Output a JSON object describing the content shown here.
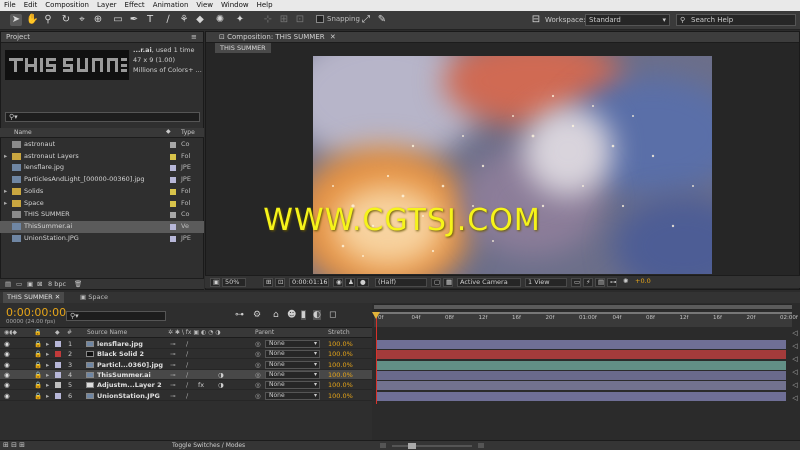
{
  "menu": [
    "File",
    "Edit",
    "Composition",
    "Layer",
    "Effect",
    "Animation",
    "View",
    "Window",
    "Help"
  ],
  "toolbar": {
    "snapping_label": "Snapping",
    "workspace_label": "Workspace:",
    "workspace_value": "Standard",
    "search_placeholder": "Search Help"
  },
  "project": {
    "tab": "Project",
    "preview_name": "...r.ai",
    "preview_used": ", used 1 time",
    "preview_dims": "47 x 9 (1.00)",
    "preview_colors": "Millions of Colors+ ...",
    "col_name": "Name",
    "col_type": "Type",
    "items": [
      {
        "name": "astronaut",
        "type": "Co",
        "label_color": "#a7a7a7",
        "icon": "composition-icon"
      },
      {
        "name": "astronaut Layers",
        "type": "Fol",
        "label_color": "#d8c34a",
        "icon": "folder-icon"
      },
      {
        "name": "lensflare.jpg",
        "type": "JPE",
        "label_color": "#b7b7d8",
        "icon": "image-icon"
      },
      {
        "name": "ParticlesAndLight_[00000-00360].jpg",
        "type": "JPE",
        "label_color": "#b7b7d8",
        "icon": "image-sequence-icon"
      },
      {
        "name": "Solids",
        "type": "Fol",
        "label_color": "#d8c34a",
        "icon": "folder-icon"
      },
      {
        "name": "Space",
        "type": "Fol",
        "label_color": "#d8c34a",
        "icon": "folder-icon"
      },
      {
        "name": "THIS SUMMER",
        "type": "Co",
        "label_color": "#a7a7a7",
        "icon": "composition-icon"
      },
      {
        "name": "ThisSummer.ai",
        "type": "Ve",
        "label_color": "#b7b7d8",
        "icon": "vector-file-icon"
      },
      {
        "name": "UnionStation.JPG",
        "type": "JPE",
        "label_color": "#b7b7d8",
        "icon": "image-icon"
      }
    ],
    "bpc": "8 bpc"
  },
  "composition": {
    "tab": "Composition: THIS SUMMER",
    "subtab": "THIS SUMMER",
    "watermark": "WWW.CGTSJ.COM",
    "zoom": "50%",
    "timecode": "0:00:01:16",
    "resolution": "(Half)",
    "camera": "Active Camera",
    "view": "1 View",
    "exposure": "+0.0"
  },
  "timeline": {
    "tabs": [
      "THIS SUMMER",
      "Space"
    ],
    "timecode": "0:00:00:00",
    "fps": "00000 (24.00 fps)",
    "col_source": "Source Name",
    "col_parent": "Parent",
    "col_stretch": "Stretch",
    "toggle_label": "Toggle Switches / Modes",
    "ruler": [
      "0f",
      "04f",
      "08f",
      "12f",
      "16f",
      "20f",
      "01:00f",
      "04f",
      "08f",
      "12f",
      "16f",
      "20f",
      "02:00f"
    ],
    "layers": [
      {
        "num": "1",
        "name": "lensflare.jpg",
        "label_color": "#b7b7d8",
        "parent": "None",
        "stretch": "100.0%",
        "bar_color": "#6f6f96"
      },
      {
        "num": "2",
        "name": "Black Solid 2",
        "label_color": "#c23a3a",
        "parent": "None",
        "stretch": "100.0%",
        "bar_color": "#a33b3b"
      },
      {
        "num": "3",
        "name": "Particl...0360].jpg",
        "label_color": "#b7b7d8",
        "parent": "None",
        "stretch": "100.0%",
        "bar_color": "#628f86"
      },
      {
        "num": "4",
        "name": "ThisSummer.ai",
        "label_color": "#b7b7d8",
        "parent": "None",
        "stretch": "100.0%",
        "bar_color": "#6a6a8c"
      },
      {
        "num": "5",
        "name": "Adjustm...Layer 2",
        "label_color": "#bfbfbf",
        "parent": "None",
        "stretch": "100.0%",
        "bar_color": "#72728f"
      },
      {
        "num": "6",
        "name": "UnionStation.JPG",
        "label_color": "#b7b7d8",
        "parent": "None",
        "stretch": "100.0%",
        "bar_color": "#6f6f96"
      }
    ]
  }
}
